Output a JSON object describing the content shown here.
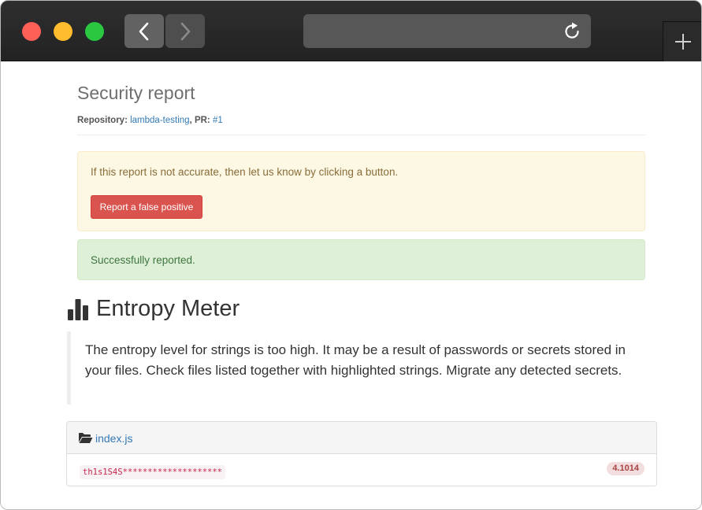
{
  "browser": {
    "traffic_lights": [
      "close",
      "minimize",
      "zoom"
    ],
    "colors": {
      "close": "#fe5f57",
      "minimize": "#febc2e",
      "zoom": "#29c840"
    },
    "back_icon": "chevron-left-icon",
    "forward_icon": "chevron-right-icon",
    "reload_icon": "reload-icon",
    "new_tab_icon": "plus-icon",
    "url": ""
  },
  "report": {
    "title": "Security report",
    "repo_label": "Repository:",
    "repo_name": "lambda-testing",
    "separator": ",",
    "pr_label": "PR:",
    "pr_number": "#1"
  },
  "alerts": {
    "warning_text": "If this report is not accurate, then let us know by clicking a button.",
    "false_positive_button": "Report a false positive",
    "success_text": "Successfully reported."
  },
  "entropy": {
    "icon": "bar-chart-icon",
    "title": "Entropy Meter",
    "description": "The entropy level for strings is too high. It may be a result of passwords or secrets stored in your files. Check files listed together with highlighted strings. Migrate any detected secrets."
  },
  "files": [
    {
      "icon": "folder-open-icon",
      "name": "index.js",
      "string": "th1s1S4S********************",
      "score": "4.1014"
    }
  ],
  "colors": {
    "danger": "#d9534f",
    "link": "#337ab7",
    "warning_bg": "#fcf8e3",
    "success_bg": "#dff0d8"
  }
}
